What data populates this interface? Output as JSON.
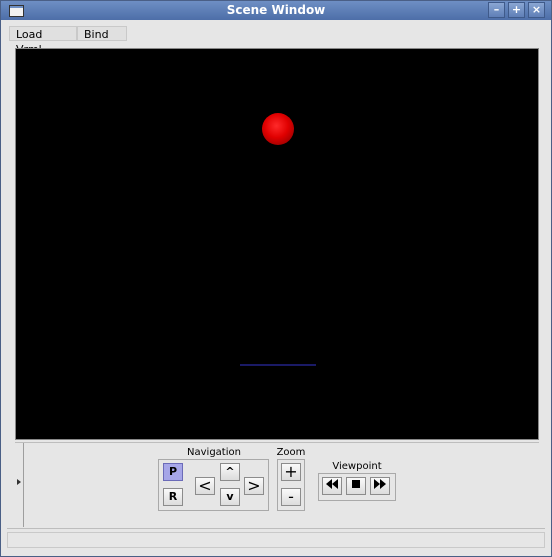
{
  "window": {
    "title": "Scene Window"
  },
  "menubar": {
    "items": [
      "Load Vrml",
      "Bind"
    ]
  },
  "controls": {
    "navigation": {
      "label": "Navigation",
      "pan_label": "P",
      "rotate_label": "R",
      "left_label": "<",
      "right_label": ">",
      "up_label": "^",
      "down_label": "v"
    },
    "zoom": {
      "label": "Zoom",
      "in_label": "+",
      "out_label": "-"
    },
    "viewpoint": {
      "label": "Viewpoint"
    }
  },
  "colors": {
    "titlebar": "#5a7cb6",
    "sphere": "#e00000",
    "viewport_bg": "#000000",
    "pressed": "#a6a6e8"
  },
  "icons": {
    "window": [
      "app-window-icon",
      "minimize-icon",
      "maximize-icon",
      "close-icon"
    ],
    "viewpoint": [
      "rewind-icon",
      "stop-icon",
      "fast-forward-icon"
    ]
  }
}
